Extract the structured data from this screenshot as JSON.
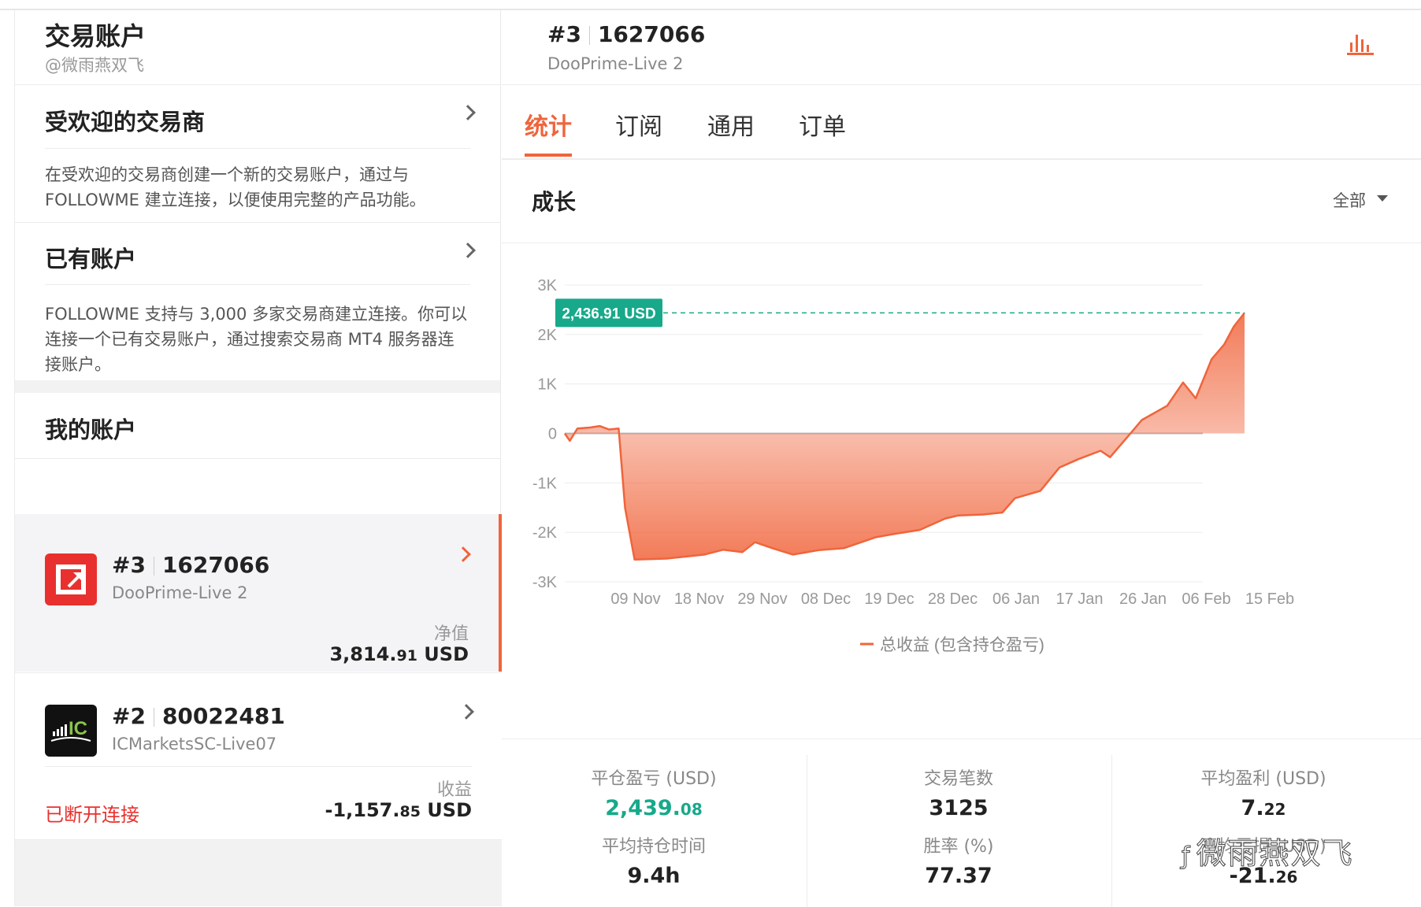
{
  "left": {
    "title": "交易账户",
    "handle": "@微雨燕双飞",
    "popular": {
      "title": "受欢迎的交易商",
      "desc": "在受欢迎的交易商创建一个新的交易账户，通过与 FOLLOWME 建立连接，以便使用完整的产品功能。"
    },
    "existing": {
      "title": "已有账户",
      "desc": "FOLLOWME 支持与 3,000 多家交易商建立连接。你可以连接一个已有交易账户，通过搜索交易商 MT4 服务器连接账户。"
    },
    "my_accounts": "我的账户",
    "accounts": [
      {
        "tag": "#3",
        "id": "1627066",
        "server": "DooPrime-Live 2",
        "label": "净值",
        "value_main": "3,814.",
        "value_dec": "91",
        "unit": " USD",
        "status": ""
      },
      {
        "tag": "#2",
        "id": "80022481",
        "server": "ICMarketsSC-Live07",
        "label": "收益",
        "value_main": "-1,157.",
        "value_dec": "85",
        "unit": " USD",
        "status": "已断开连接"
      }
    ]
  },
  "header": {
    "tag": "#3",
    "id": "1627066",
    "server": "DooPrime-Live 2"
  },
  "tabs": [
    "统计",
    "订阅",
    "通用",
    "订单"
  ],
  "growth": {
    "title": "成长",
    "filter": "全部"
  },
  "chart_data": {
    "type": "area",
    "x_ticks": [
      "09 Nov",
      "18 Nov",
      "29 Nov",
      "08 Dec",
      "19 Dec",
      "28 Dec",
      "06 Jan",
      "17 Jan",
      "26 Jan",
      "06 Feb",
      "15 Feb"
    ],
    "y_ticks": [
      "3K",
      "2K",
      "1K",
      "0",
      "-1K",
      "-2K",
      "-3K"
    ],
    "ylim": [
      -3000,
      3000
    ],
    "current_label": "2,436.91 USD",
    "legend": "总收益 (包含持仓盈亏)",
    "series": [
      {
        "name": "总收益 (包含持仓盈亏)",
        "points": [
          [
            0,
            0
          ],
          [
            0.08,
            -150
          ],
          [
            0.2,
            100
          ],
          [
            0.4,
            120
          ],
          [
            0.55,
            150
          ],
          [
            0.7,
            80
          ],
          [
            0.85,
            100
          ],
          [
            0.95,
            -1500
          ],
          [
            1.1,
            -2550
          ],
          [
            1.6,
            -2530
          ],
          [
            2.2,
            -2450
          ],
          [
            2.5,
            -2350
          ],
          [
            2.8,
            -2400
          ],
          [
            3.0,
            -2200
          ],
          [
            3.3,
            -2330
          ],
          [
            3.6,
            -2450
          ],
          [
            4.0,
            -2360
          ],
          [
            4.4,
            -2320
          ],
          [
            4.9,
            -2100
          ],
          [
            5.2,
            -2030
          ],
          [
            5.6,
            -1950
          ],
          [
            6.0,
            -1720
          ],
          [
            6.2,
            -1660
          ],
          [
            6.6,
            -1640
          ],
          [
            6.9,
            -1600
          ],
          [
            7.1,
            -1310
          ],
          [
            7.5,
            -1160
          ],
          [
            7.8,
            -690
          ],
          [
            8.1,
            -520
          ],
          [
            8.45,
            -350
          ],
          [
            8.6,
            -480
          ],
          [
            8.9,
            -30
          ],
          [
            9.1,
            270
          ],
          [
            9.5,
            560
          ],
          [
            9.75,
            1030
          ],
          [
            9.95,
            710
          ],
          [
            10.2,
            1500
          ],
          [
            10.4,
            1800
          ],
          [
            10.55,
            2160
          ],
          [
            10.72,
            2436.91
          ]
        ]
      }
    ]
  },
  "stats": [
    {
      "k": "平仓盈亏 (USD)",
      "main": "2,439.",
      "dec": "08",
      "color": "#17a98a"
    },
    {
      "k": "交易笔数",
      "main": "3125",
      "dec": "",
      "color": "#222"
    },
    {
      "k": "平均盈利 (USD)",
      "main": "7.",
      "dec": "22",
      "color": "#222"
    },
    {
      "k": "平均持仓时间",
      "main": "9.4h",
      "dec": "",
      "color": "#222"
    },
    {
      "k": "胜率 (%)",
      "main": "77.37",
      "dec": "",
      "color": "#222"
    },
    {
      "k": "平均亏损 (USD)",
      "main": "-21.",
      "dec": "26",
      "color": "#222"
    }
  ],
  "watermark": "微雨燕双飞",
  "colors": {
    "accent": "#f0643b",
    "green": "#17a98a",
    "red": "#e8312e"
  }
}
